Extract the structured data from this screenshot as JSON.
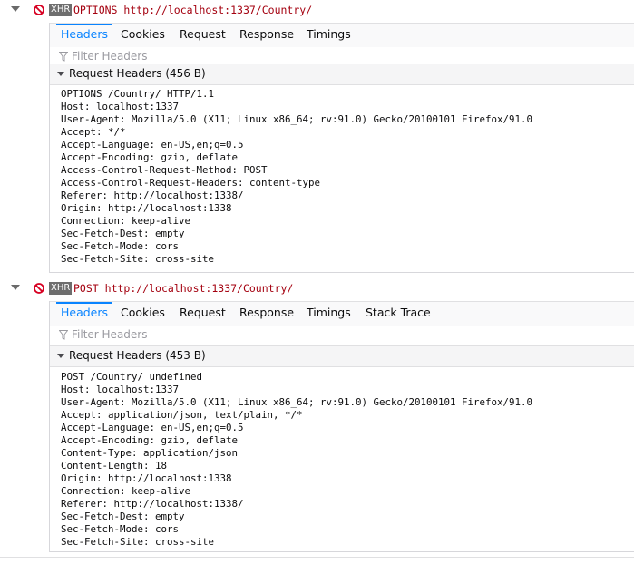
{
  "requests": [
    {
      "badge": "XHR",
      "method": "OPTIONS",
      "url": "http://localhost:1337/Country/",
      "tabs": [
        "Headers",
        "Cookies",
        "Request",
        "Response",
        "Timings"
      ],
      "filter_placeholder": "Filter Headers",
      "section_title": "Request Headers (456 B)",
      "raw_lines": [
        "OPTIONS /Country/ HTTP/1.1",
        "Host: localhost:1337",
        "User-Agent: Mozilla/5.0 (X11; Linux x86_64; rv:91.0) Gecko/20100101 Firefox/91.0",
        "Accept: */*",
        "Accept-Language: en-US,en;q=0.5",
        "Accept-Encoding: gzip, deflate",
        "Access-Control-Request-Method: POST",
        "Access-Control-Request-Headers: content-type",
        "Referer: http://localhost:1338/",
        "Origin: http://localhost:1338",
        "Connection: keep-alive",
        "Sec-Fetch-Dest: empty",
        "Sec-Fetch-Mode: cors",
        "Sec-Fetch-Site: cross-site"
      ]
    },
    {
      "badge": "XHR",
      "method": "POST",
      "url": "http://localhost:1337/Country/",
      "tabs": [
        "Headers",
        "Cookies",
        "Request",
        "Response",
        "Timings",
        "Stack Trace"
      ],
      "filter_placeholder": "Filter Headers",
      "section_title": "Request Headers (453 B)",
      "raw_lines": [
        "POST /Country/ undefined",
        "Host: localhost:1337",
        "User-Agent: Mozilla/5.0 (X11; Linux x86_64; rv:91.0) Gecko/20100101 Firefox/91.0",
        "Accept: application/json, text/plain, */*",
        "Accept-Language: en-US,en;q=0.5",
        "Accept-Encoding: gzip, deflate",
        "Content-Type: application/json",
        "Content-Length: 18",
        "Origin: http://localhost:1338",
        "Connection: keep-alive",
        "Referer: http://localhost:1338/",
        "Sec-Fetch-Dest: empty",
        "Sec-Fetch-Mode: cors",
        "Sec-Fetch-Site: cross-site"
      ]
    }
  ],
  "colors": {
    "accent": "#0a84ff",
    "error": "#a4000f",
    "badge_bg": "#6e6e6e"
  },
  "icons": {
    "twisty": "chevron-down-icon",
    "blocked": "blocked-icon",
    "filter": "filter-icon"
  }
}
